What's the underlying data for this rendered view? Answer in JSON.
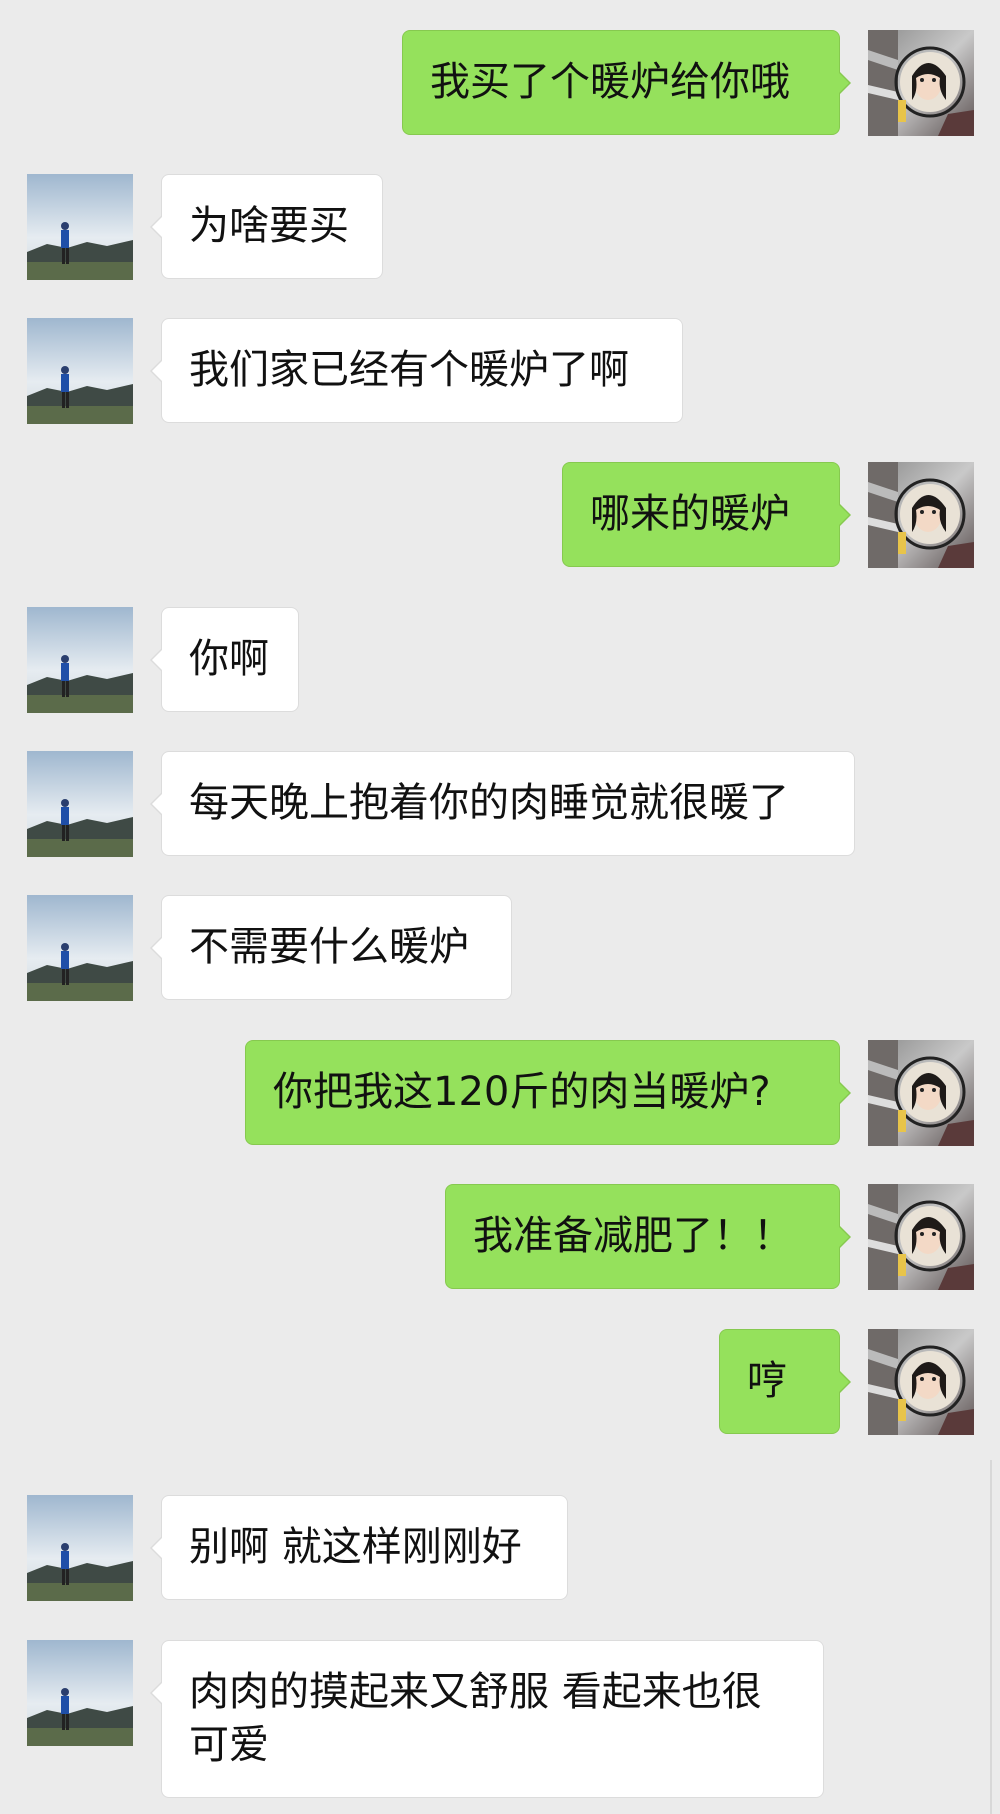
{
  "chat": {
    "messages": [
      {
        "side": "right",
        "text": "我买了个暖炉给你哦"
      },
      {
        "side": "left",
        "text": "为啥要买"
      },
      {
        "side": "left",
        "text": "我们家已经有个暖炉了啊"
      },
      {
        "side": "right",
        "text": "哪来的暖炉"
      },
      {
        "side": "left",
        "text": "你啊"
      },
      {
        "side": "left",
        "text": "每天晚上抱着你的肉睡觉就很暖了"
      },
      {
        "side": "left",
        "text": "不需要什么暖炉"
      },
      {
        "side": "right",
        "text": "你把我这120斤的肉当暖炉?"
      },
      {
        "side": "right",
        "text": "我准备减肥了！！"
      },
      {
        "side": "right",
        "text": "哼"
      },
      {
        "side": "left",
        "text": "别啊 就这样刚刚好"
      },
      {
        "side": "left",
        "text": "肉肉的摸起来又舒服 看起来也很可爱"
      }
    ]
  },
  "colors": {
    "background": "#ebebeb",
    "sent_bubble": "#95e15c",
    "received_bubble": "#ffffff"
  },
  "icons": {
    "self_avatar": "avatar-girl-photo",
    "contact_avatar": "avatar-man-landscape-photo"
  }
}
